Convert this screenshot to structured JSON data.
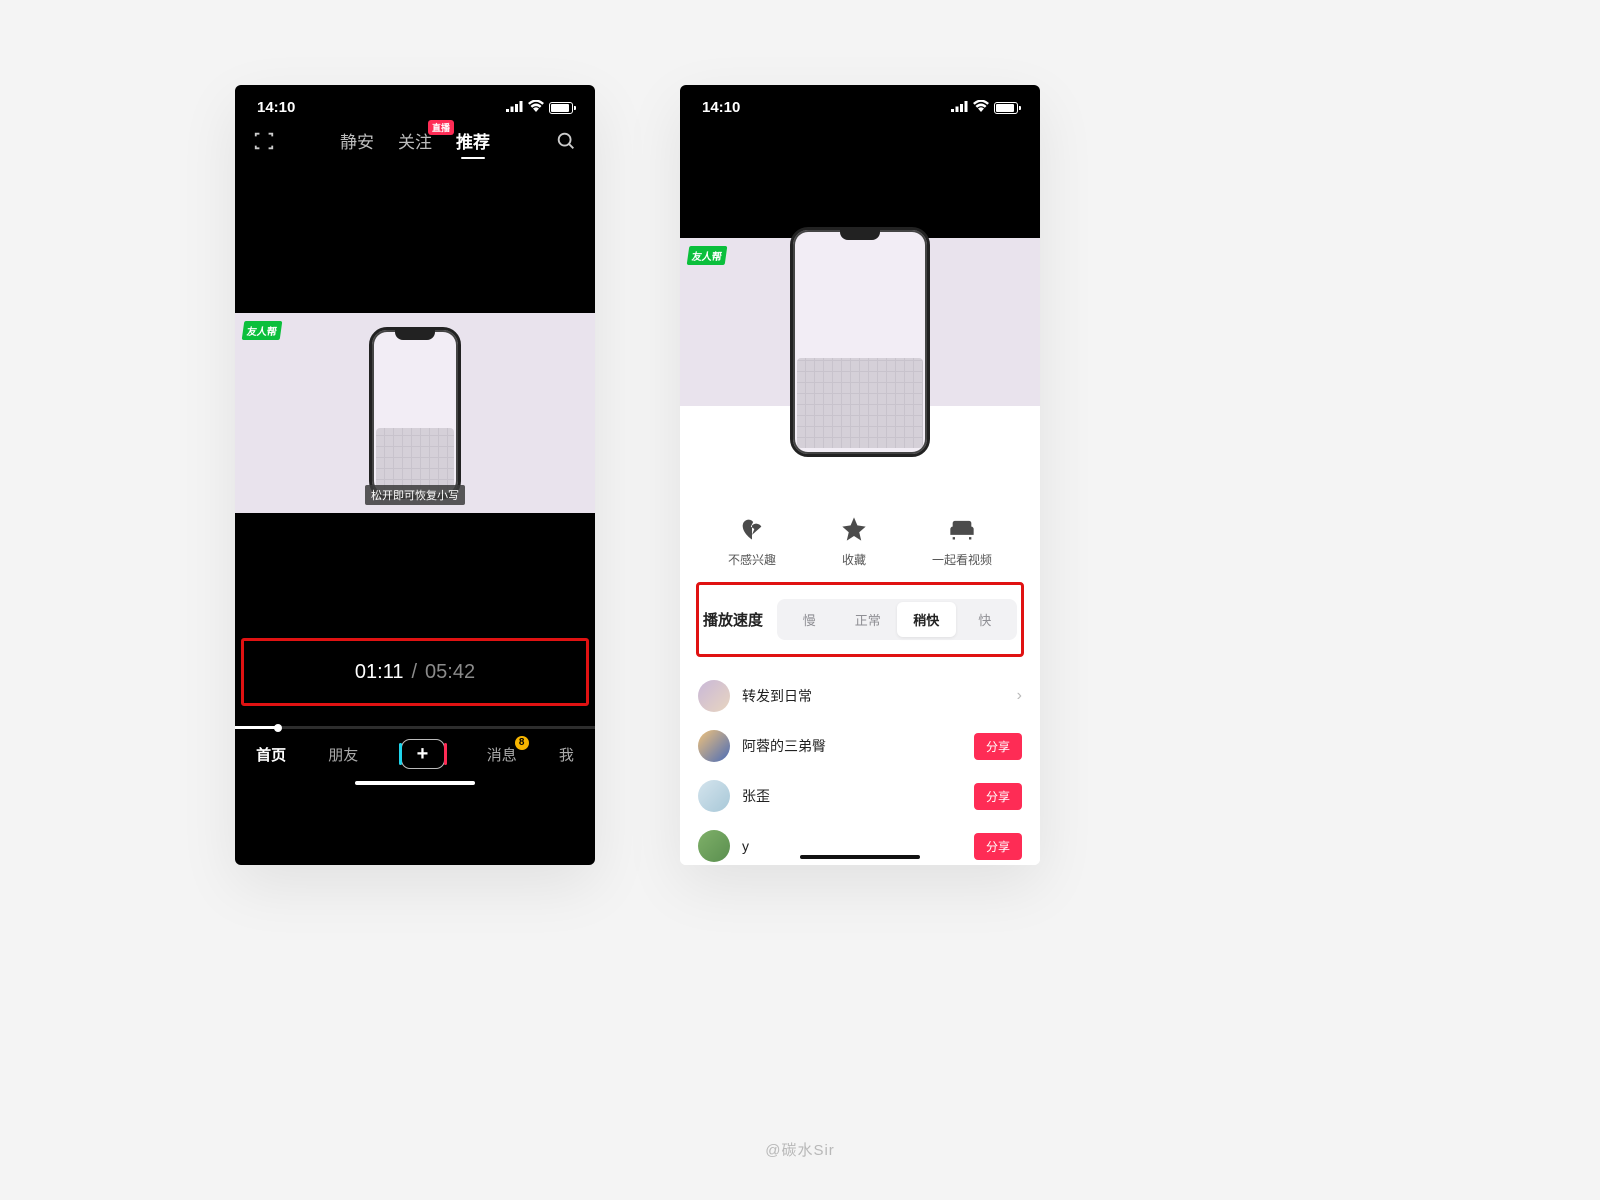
{
  "status": {
    "time": "14:10"
  },
  "left": {
    "tabs": {
      "city": "静安",
      "follow": "关注",
      "recommend": "推荐",
      "live_badge": "直播"
    },
    "caption": "松开即可恢复小写",
    "playback": {
      "current": "01:11",
      "separator": "/",
      "duration": "05:42"
    },
    "bottomnav": {
      "home": "首页",
      "friends": "朋友",
      "messages": "消息",
      "me": "我",
      "msg_badge": "8"
    }
  },
  "right": {
    "actions": {
      "dislike": "不感兴趣",
      "favorite": "收藏",
      "watch_together": "一起看视频"
    },
    "speed": {
      "label": "播放速度",
      "options": [
        "慢",
        "正常",
        "稍快",
        "快"
      ],
      "selected": "稍快"
    },
    "share": {
      "forward_daily": "转发到日常",
      "contacts": [
        "阿蓉的三弟臀",
        "张歪",
        "y"
      ],
      "share_btn": "分享"
    }
  },
  "watermark": "@碳水Sir"
}
